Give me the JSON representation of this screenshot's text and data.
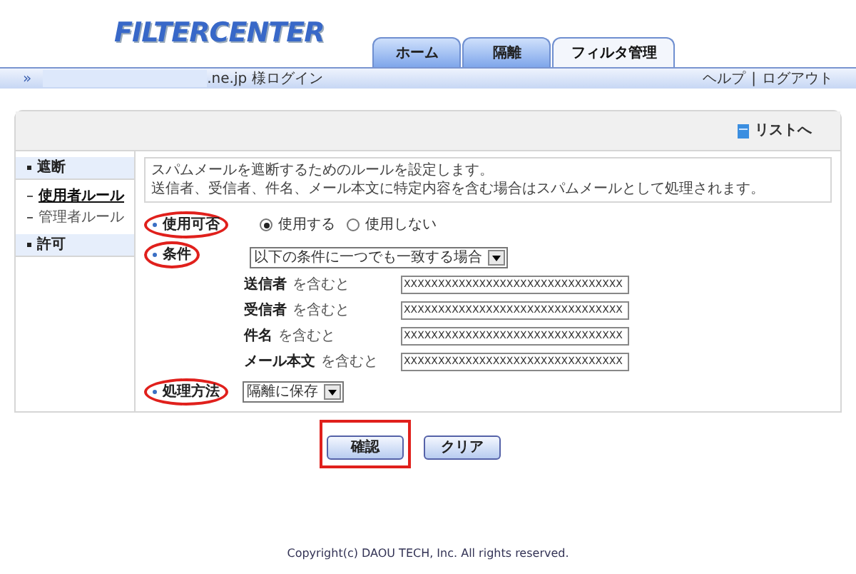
{
  "logo": "FILTERCENTER",
  "tabs": [
    {
      "label": "ホーム",
      "selected": false
    },
    {
      "label": "隔離",
      "selected": false
    },
    {
      "label": "フィルタ管理",
      "selected": true
    }
  ],
  "user_bar": {
    "marker": "»",
    "login": ".ne.jp 様ログイン",
    "links": [
      "ヘルプ",
      "ログアウト"
    ],
    "separator": "|"
  },
  "list_link": "リストへ",
  "sidebar": [
    {
      "label": "遮断",
      "children": [
        {
          "label": "使用者ルール",
          "selected": true
        },
        {
          "label": "管理者ルール",
          "selected": false
        }
      ]
    },
    {
      "label": "許可"
    }
  ],
  "description": [
    "スパムメールを遮断するためのルールを設定します。",
    "送信者、受信者、件名、メール本文に特定内容を含む場合はスパムメールとして処理されます。"
  ],
  "usage": {
    "label": "使用可否",
    "highlighted": true,
    "options": [
      {
        "label": "使用する",
        "selected": true
      },
      {
        "label": "使用しない",
        "selected": false
      }
    ]
  },
  "condition": {
    "label": "条件",
    "highlighted": true,
    "value": "以下の条件に一つでも一致する場合"
  },
  "conditions": [
    {
      "field": "送信者",
      "suffix": "を含むと",
      "value": "XXXXXXXXXXXXXXXXXXXXXXXXXXXXXXXX"
    },
    {
      "field": "受信者",
      "suffix": "を含むと",
      "value": "XXXXXXXXXXXXXXXXXXXXXXXXXXXXXXXX"
    },
    {
      "field": "件名",
      "suffix": "を含むと",
      "value": "XXXXXXXXXXXXXXXXXXXXXXXXXXXXXXXX"
    },
    {
      "field": "メール本文",
      "suffix": "を含むと",
      "value": "XXXXXXXXXXXXXXXXXXXXXXXXXXXXXXXX"
    }
  ],
  "action": {
    "label": "処理方法",
    "highlighted": true,
    "value": "隔離に保存"
  },
  "buttons": [
    {
      "label": "確認",
      "highlighted": true
    },
    {
      "label": "クリア",
      "highlighted": false
    }
  ],
  "copyright": "Copyright(c) DAOU TECH, Inc. All rights reserved."
}
